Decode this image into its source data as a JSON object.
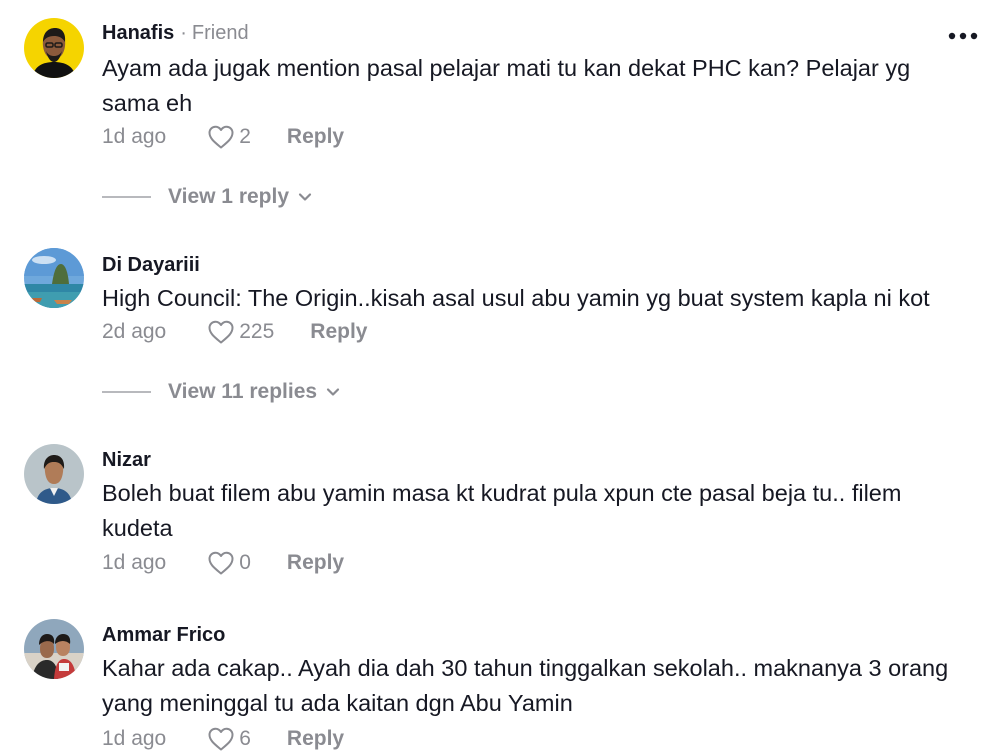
{
  "comments": [
    {
      "username": "Hanafis",
      "separator": "·",
      "friend_label": "Friend",
      "avatar_icon": "person-avatar-icon",
      "text": "Ayam ada jugak mention pasal pelajar mati tu kan dekat PHC kan? Pelajar yg sama eh",
      "timestamp": "1d ago",
      "likes": "2",
      "reply_label": "Reply",
      "view_replies": "View 1 reply",
      "more_icon": "more-options-icon"
    },
    {
      "username": "Di Dayariii",
      "avatar_icon": "landscape-avatar-icon",
      "text": "High Council: The Origin..kisah asal usul abu yamin yg buat system kapla ni kot",
      "timestamp": "2d ago",
      "likes": "225",
      "reply_label": "Reply",
      "view_replies": "View 11 replies"
    },
    {
      "username": "Nizar",
      "avatar_icon": "person-avatar-icon",
      "text": "Boleh buat filem abu yamin masa kt kudrat pula xpun cte pasal beja tu.. filem kudeta",
      "timestamp": "1d ago",
      "likes": "0",
      "reply_label": "Reply"
    },
    {
      "username": "Ammar Frico",
      "avatar_icon": "person-avatar-icon",
      "text": "Kahar ada cakap.. Ayah dia dah 30 tahun tinggalkan sekolah.. maknanya 3 orang yang meninggal tu ada kaitan dgn Abu Yamin",
      "timestamp": "1d ago",
      "likes": "6",
      "reply_label": "Reply"
    }
  ],
  "colors": {
    "text_primary": "#161823",
    "text_secondary": "#8a8b91",
    "accent_avatar_1": "#f5d400",
    "divider": "#b8b9bd"
  },
  "icons": {
    "like": "heart-outline-icon",
    "expand": "chevron-down-icon",
    "more": "more-options-icon"
  }
}
